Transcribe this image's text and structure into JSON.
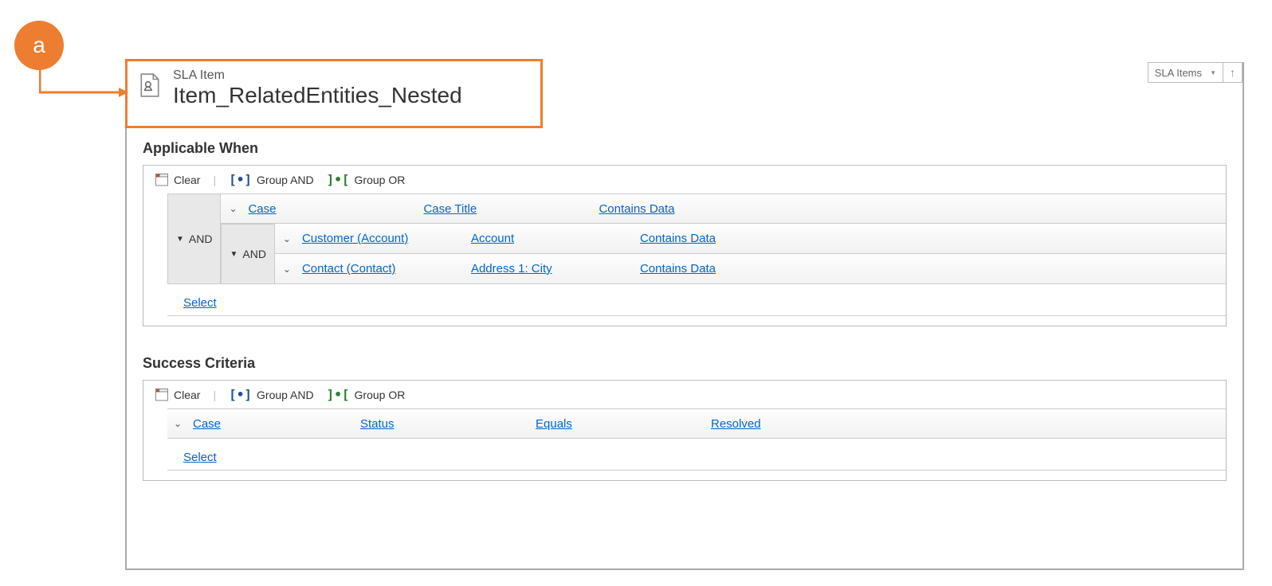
{
  "callout": {
    "label": "a"
  },
  "header": {
    "entity_type": "SLA Item",
    "title": "Item_RelatedEntities_Nested",
    "nav_label": "SLA Items"
  },
  "applicable_when": {
    "title": "Applicable When",
    "toolbar": {
      "clear": "Clear",
      "group_and": "Group AND",
      "group_or": "Group OR"
    },
    "group_label": "AND",
    "rows": [
      {
        "entity": "Case",
        "field": "Case Title",
        "operator": "Contains Data"
      }
    ],
    "nested_group_label": "AND",
    "nested_rows": [
      {
        "entity": "Customer (Account)",
        "field": "Account",
        "operator": "Contains Data"
      },
      {
        "entity": "Contact (Contact)",
        "field": "Address 1: City",
        "operator": "Contains Data"
      }
    ],
    "select_label": "Select"
  },
  "success_criteria": {
    "title": "Success Criteria",
    "toolbar": {
      "clear": "Clear",
      "group_and": "Group AND",
      "group_or": "Group OR"
    },
    "rows": [
      {
        "entity": "Case",
        "field": "Status",
        "operator": "Equals",
        "value": "Resolved"
      }
    ],
    "select_label": "Select"
  }
}
